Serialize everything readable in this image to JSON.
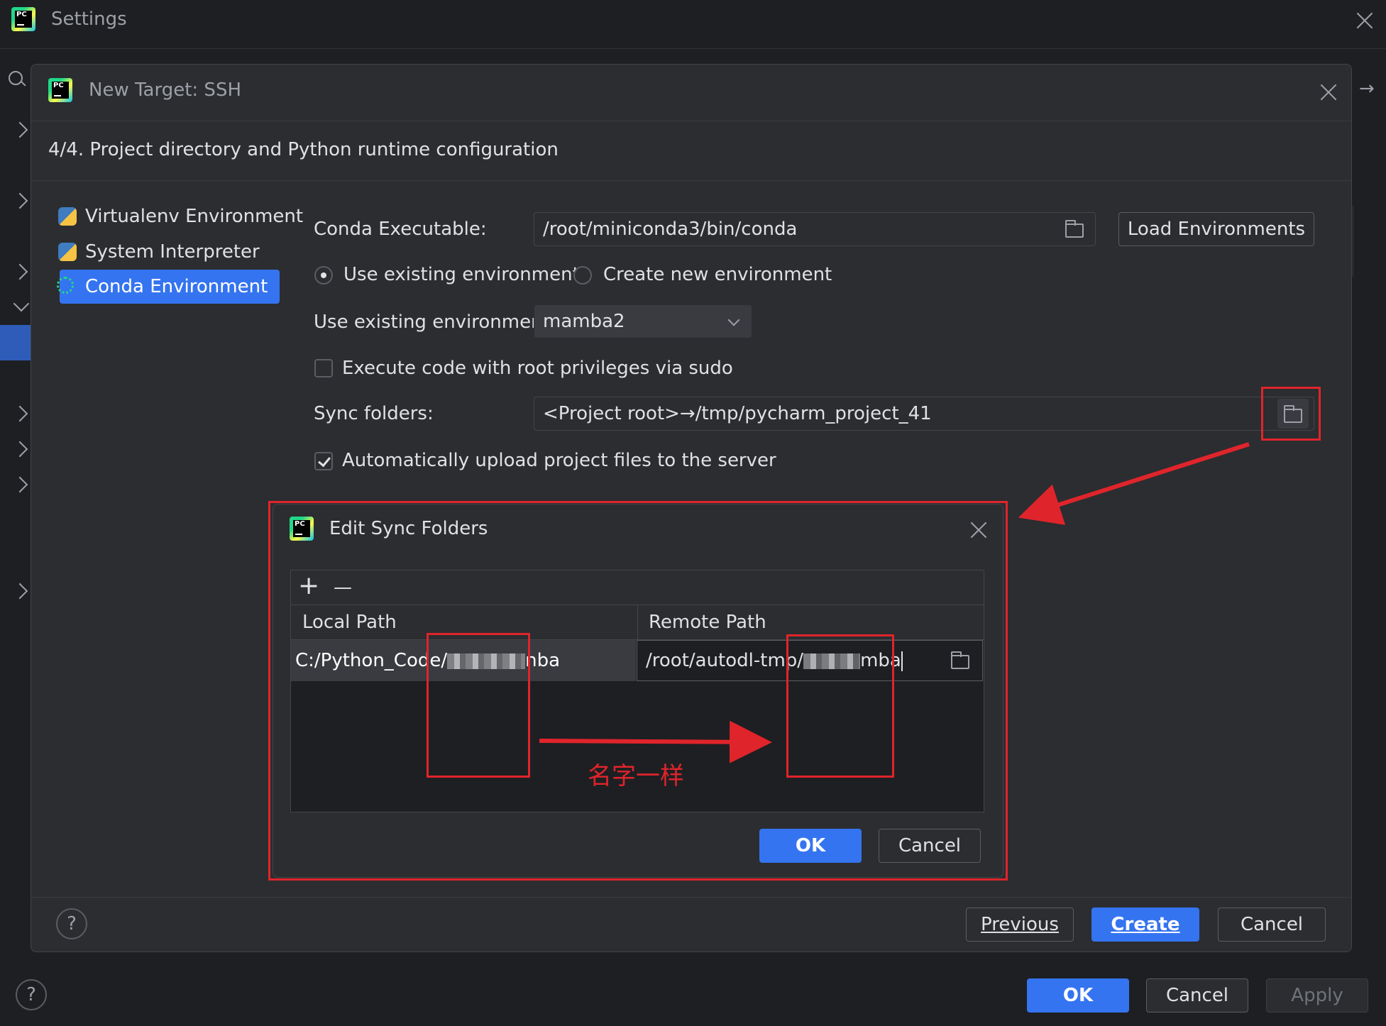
{
  "settings": {
    "title": "Settings",
    "ok_label": "OK",
    "cancel_label": "Cancel",
    "apply_label": "Apply",
    "help_label": "?"
  },
  "ssh_dialog": {
    "title": "New Target: SSH",
    "step_text": "4/4. Project directory and Python runtime configuration",
    "env_types": [
      {
        "label": "Virtualenv Environment",
        "icon": "virtualenv-icon"
      },
      {
        "label": "System Interpreter",
        "icon": "python-icon"
      },
      {
        "label": "Conda Environment",
        "icon": "conda-icon",
        "selected": true
      }
    ],
    "conda_executable_label": "Conda Executable:",
    "conda_executable_value": "/root/miniconda3/bin/conda",
    "load_envs_label": "Load Environments",
    "use_existing_radio": "Use existing environment",
    "create_new_radio": "Create new environment",
    "existing_env_label": "Use existing environment:",
    "existing_env_value": "mamba2",
    "sudo_label": "Execute code with root privileges via sudo",
    "sync_label": "Sync folders:",
    "sync_value": "<Project root>→/tmp/pycharm_project_41",
    "auto_upload_label": "Automatically upload project files to the server",
    "help_label": "?",
    "previous_label": "Previous",
    "create_label": "Create",
    "cancel_label": "Cancel"
  },
  "sync_dialog": {
    "title": "Edit Sync Folders",
    "add_label": "+",
    "remove_label": "—",
    "columns": [
      "Local Path",
      "Remote Path"
    ],
    "local_prefix": "C:/Python_Code/",
    "local_suffix": "nba",
    "remote_prefix": "/root/autodl-tmp/",
    "remote_suffix": "mba",
    "ok_label": "OK",
    "cancel_label": "Cancel"
  },
  "annotation": {
    "text": "名字一样",
    "color": "#e0242b"
  }
}
